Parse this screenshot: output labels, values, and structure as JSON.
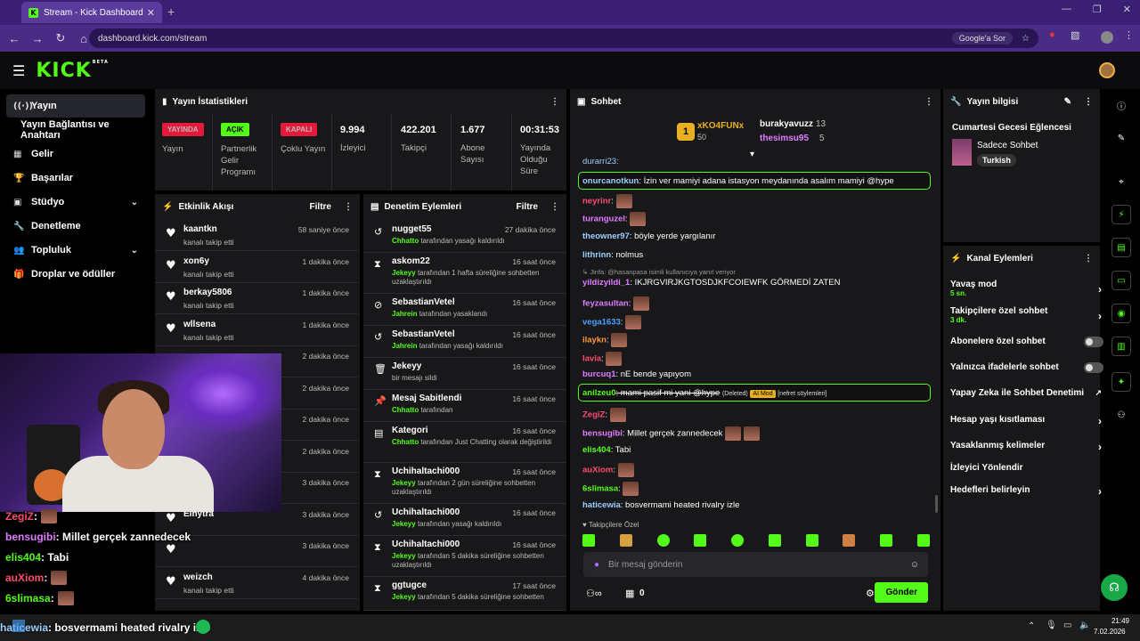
{
  "browser": {
    "tab_title": "Stream - Kick Dashboard",
    "tab_favicon": "K",
    "tab_close": "✕",
    "new_tab": "+",
    "url": "dashboard.kick.com/stream",
    "google_chip": "Google'a Sor",
    "win_min": "—",
    "win_max": "❐",
    "win_close": "✕"
  },
  "kick": {
    "logo": "KICK",
    "beta": "BETA"
  },
  "sidebar": {
    "items": [
      {
        "label": "Yayın",
        "icon": "((·))"
      },
      {
        "label": "Yayın Bağlantısı ve Anahtarı",
        "icon": ""
      },
      {
        "label": "Gelir",
        "icon": "▦"
      },
      {
        "label": "Başarılar",
        "icon": "🏆"
      },
      {
        "label": "Stüdyo",
        "icon": "▣",
        "chev": "⌄"
      },
      {
        "label": "Denetleme",
        "icon": "🔧"
      },
      {
        "label": "Topluluk",
        "icon": "👥",
        "chev": "⌄"
      },
      {
        "label": "Droplar ve ödüller",
        "icon": "🎁"
      }
    ]
  },
  "stats": {
    "title": "Yayın İstatistikleri",
    "yayinda": "YAYINDA",
    "yayin_lbl": "Yayın",
    "acik": "AÇIK",
    "partner_lbl": "Partnerlik Gelir Programı",
    "kapali": "KAPALI",
    "coklu_lbl": "Çoklu Yayın",
    "izleyici": "9.994",
    "izleyici_lbl": "İzleyici",
    "takipci": "422.201",
    "takipci_lbl": "Takipçi",
    "abone": "1.677",
    "abone_lbl": "Abone Sayısı",
    "sure": "00:31:53",
    "sure_lbl": "Yayında Olduğu Süre"
  },
  "activity": {
    "title": "Etkinlik Akışı",
    "filter": "Filtre",
    "rows": [
      {
        "name": "kaantkn",
        "sub": "kanalı takip etti",
        "time": "58 saniye önce"
      },
      {
        "name": "xon6y",
        "sub": "kanalı takip etti",
        "time": "1 dakika önce"
      },
      {
        "name": "berkay5806",
        "sub": "kanalı takip etti",
        "time": "1 dakika önce"
      },
      {
        "name": "wllsena",
        "sub": "kanalı takip etti",
        "time": "1 dakika önce"
      },
      {
        "name": "",
        "sub": "",
        "time": "2 dakika önce"
      },
      {
        "name": "",
        "sub": "",
        "time": "2 dakika önce"
      },
      {
        "name": "",
        "sub": "",
        "time": "2 dakika önce"
      },
      {
        "name": "",
        "sub": "",
        "time": "2 dakika önce"
      },
      {
        "name": "",
        "sub": "",
        "time": "3 dakika önce"
      },
      {
        "name": "Elhytra",
        "sub": "",
        "time": "3 dakika önce"
      },
      {
        "name": "",
        "sub": "",
        "time": "3 dakika önce"
      },
      {
        "name": "weizch",
        "sub": "kanalı takip etti",
        "time": "4 dakika önce"
      }
    ]
  },
  "moderation": {
    "title": "Denetim Eylemleri",
    "filter": "Filtre",
    "rows": [
      {
        "icon": "↺",
        "name": "nugget55",
        "who": "Chhatto",
        "sub": "tarafından yasağı kaldırıldı",
        "time": "27 dakika önce"
      },
      {
        "icon": "⧗",
        "name": "askom22",
        "who": "Jekeyy",
        "sub": "tarafından 1 hafta süreliğine sohbetten uzaklaştırıldı",
        "time": "16 saat önce"
      },
      {
        "icon": "⊘",
        "name": "SebastianVetel",
        "who": "Jahrein",
        "sub": "tarafından yasaklandı",
        "time": "16 saat önce"
      },
      {
        "icon": "↺",
        "name": "SebastianVetel",
        "who": "Jahrein",
        "sub": "tarafından yasağı kaldırıldı",
        "time": "16 saat önce"
      },
      {
        "icon": "🗑",
        "name": "Jekeyy",
        "who": "",
        "sub": "bir mesajı sildi",
        "time": "16 saat önce"
      },
      {
        "icon": "📌",
        "name": "Mesaj Sabitlendi",
        "who": "Chhatto",
        "sub": "tarafından",
        "time": "16 saat önce"
      },
      {
        "icon": "▤",
        "name": "Kategori",
        "who": "Chhatto",
        "sub": "tarafından Just Chatting olarak değiştirildi",
        "time": "16 saat önce"
      },
      {
        "icon": "⧗",
        "name": "Uchihaltachi000",
        "who": "Jekeyy",
        "sub": "tarafından 2 gün süreliğine sohbetten uzaklaştırıldı",
        "time": "16 saat önce"
      },
      {
        "icon": "↺",
        "name": "Uchihaltachi000",
        "who": "Jekeyy",
        "sub": "tarafından yasağı kaldırıldı",
        "time": "16 saat önce"
      },
      {
        "icon": "⧗",
        "name": "Uchihaltachi000",
        "who": "Jekeyy",
        "sub": "tarafından 5 dakika süreliğine sohbetten uzaklaştırıldı",
        "time": "16 saat önce"
      },
      {
        "icon": "⧗",
        "name": "ggtugce",
        "who": "Jekeyy",
        "sub": "tarafından 5 dakika süreliğine sohbetten",
        "time": "17 saat önce"
      }
    ]
  },
  "chat": {
    "title": "Sohbet",
    "top1_name": "xKO4FUNx",
    "top1_count": "50",
    "top2_name": "burakyavuzz",
    "top2_count": "13",
    "top3_name": "thesimsu95",
    "top3_count": "5",
    "messages": [
      {
        "user": "onurcanotkun",
        "color": "#9ad0ff",
        "text": ": İzin ver mamiyi adana istasyon meydanında asalım mamiyi @hype",
        "hl": true
      },
      {
        "user": "neyrinr",
        "color": "#ff4b6e",
        "text": ":"
      },
      {
        "user": "turanguzel",
        "color": "#e07cff",
        "text": ":"
      },
      {
        "user": "theowner97",
        "color": "#9ad0ff",
        "text": ": böyle yerde yargılanır"
      },
      {
        "user": "lithrinn",
        "color": "#9ad0ff",
        "text": ": nolmus"
      },
      {
        "user": "yildizyildi_1",
        "color": "#e07cff",
        "text": ": IKJRGVIRJKGTOSDJKFCOIEWFK GÖRMEDİ ZATEN"
      },
      {
        "user": "feyzasultan",
        "color": "#e07cff",
        "text": ":"
      },
      {
        "user": "vega1633",
        "color": "#4aa3ff",
        "text": ":"
      },
      {
        "user": "ilaykn",
        "color": "#ff9a3c",
        "text": ":"
      },
      {
        "user": "lavia",
        "color": "#ff4b6e",
        "text": ":"
      },
      {
        "user": "burcuq1",
        "color": "#e07cff",
        "text": ": nE bende yapıyom"
      },
      {
        "user": "anilzeu0",
        "color": "#53fc18",
        "text": ": mami pasif mi yani @hype",
        "hl": true
      },
      {
        "user": "ZegiZ",
        "color": "#ff4b6e",
        "text": ":"
      },
      {
        "user": "bensugibi",
        "color": "#e07cff",
        "text": ": Millet gerçek zannedecek"
      },
      {
        "user": "elis404",
        "color": "#53fc18",
        "text": ": Tabi"
      },
      {
        "user": "auXiom",
        "color": "#ff4b6e",
        "text": ":"
      },
      {
        "user": "6slimasa",
        "color": "#53fc18",
        "text": ":"
      },
      {
        "user": "haticewia",
        "color": "#9ad0ff",
        "text": ": bosvermami heated rivalry izle"
      }
    ],
    "top_partial": "durarri23:",
    "reply_note": "↳ Jinfa: @hasanpasa isimli kullanıcıya yanıt veriyor",
    "deleted": "(Deleted)",
    "aimod": "AI Mod",
    "nefret": "[nefret söylemleri]",
    "followers_only": "Takipçilere Özel",
    "placeholder": "Bir mesaj gönderin",
    "send": "Gönder",
    "count": "0"
  },
  "overlay": {
    "lines": [
      {
        "user": "ZegiZ",
        "color": "#ff4b6e",
        "text": " :"
      },
      {
        "user": "bensugibi",
        "color": "#e07cff",
        "text": " : Millet gerçek zannedecek"
      },
      {
        "user": "elis404",
        "color": "#53fc18",
        "text": " : Tabi"
      },
      {
        "user": "auXiom",
        "color": "#ff4b6e",
        "text": " :"
      },
      {
        "user": "6slimasa",
        "color": "#53fc18",
        "text": " :"
      },
      {
        "user": "haticewia",
        "color": "#9ad0ff",
        "text": " : bosvermami heated rivalry izle"
      }
    ]
  },
  "info": {
    "title": "Yayın bilgisi",
    "stream_title": "Cumartesi Gecesi Eğlencesi",
    "category": "Sadece Sohbet",
    "tag": "Turkish"
  },
  "channel": {
    "title": "Kanal Eylemleri",
    "slow": "Yavaş mod",
    "slow_sub": "5 sn.",
    "followers": "Takipçilere özel sohbet",
    "followers_sub": "3 dk.",
    "subs": "Abonelere özel sohbet",
    "emotes": "Yalnızca ifadelerle sohbet",
    "ai": "Yapay Zeka ile Sohbet Denetimi",
    "age": "Hesap yaşı kısıtlaması",
    "banned": "Yasaklanmış kelimeler",
    "redirect": "İzleyici Yönlendir",
    "goals": "Hedefleri belirleyin"
  },
  "taskbar": {
    "time": "21:49",
    "date": "7.02.2026"
  },
  "colors": {
    "accent": "#53fc18",
    "panel": "#18181b",
    "live": "#e5193a"
  }
}
